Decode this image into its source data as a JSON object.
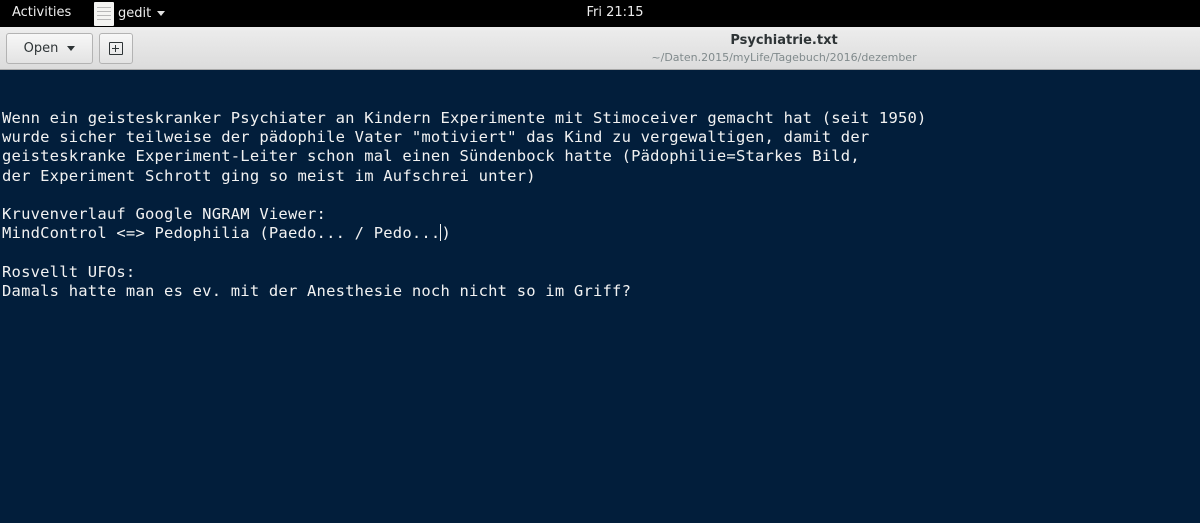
{
  "topbar": {
    "activities": "Activities",
    "app_name": "gedit",
    "clock": "Fri 21:15"
  },
  "header": {
    "open_label": "Open",
    "title": "Psychiatrie.txt",
    "path": "~/Daten.2015/myLife/Tagebuch/2016/dezember"
  },
  "editor": {
    "lines": [
      "Wenn ein geisteskranker Psychiater an Kindern Experimente mit Stimoceiver gemacht hat (seit 1950)",
      "wurde sicher teilweise der pädophile Vater \"motiviert\" das Kind zu vergewaltigen, damit der",
      "geisteskranke Experiment-Leiter schon mal einen Sündenbock hatte (Pädophilie=Starkes Bild,",
      "der Experiment Schrott ging so meist im Aufschrei unter)",
      "",
      "Kruvenverlauf Google NGRAM Viewer:",
      "MindControl <=> Pedophilia (Paedo... / Pedo...",
      ")",
      "",
      "Rosvellt UFOs:",
      "Damals hatte man es ev. mit der Anesthesie noch nicht so im Griff?"
    ]
  }
}
